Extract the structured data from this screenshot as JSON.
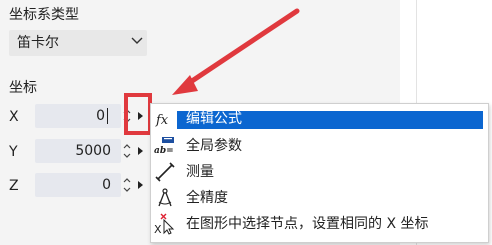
{
  "coordinate_system": {
    "label": "坐标系类型",
    "selected": "笛卡尔"
  },
  "coordinates": {
    "label": "坐标",
    "rows": [
      {
        "axis": "X",
        "value": "0"
      },
      {
        "axis": "Y",
        "value": "5000"
      },
      {
        "axis": "Z",
        "value": "0"
      }
    ]
  },
  "context_menu": {
    "items": [
      {
        "label": "编辑公式",
        "icon": "formula-fx-icon",
        "selected": true
      },
      {
        "label": "全局参数",
        "icon": "global-params-icon",
        "selected": false
      },
      {
        "label": "测量",
        "icon": "measure-icon",
        "selected": false
      },
      {
        "label": "全精度",
        "icon": "compass-precision-icon",
        "selected": false
      },
      {
        "label": "在图形中选择节点，设置相同的 X 坐标",
        "icon": "select-node-icon",
        "selected": false
      }
    ]
  },
  "colors": {
    "highlight_box": "#e0393e",
    "menu_selection": "#0b66d0",
    "input_bg": "#e6e8ee",
    "panel_bg": "#f4f4f4"
  }
}
